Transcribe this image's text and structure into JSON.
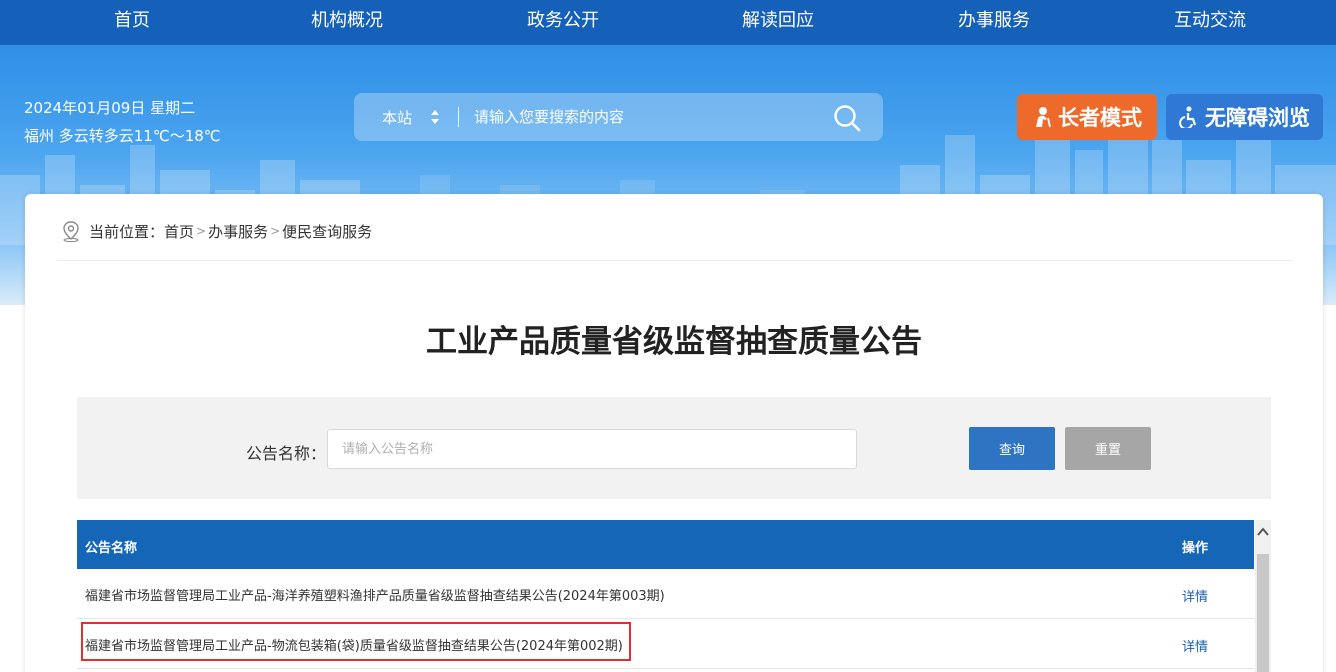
{
  "nav": {
    "items": [
      "首页",
      "机构概况",
      "政务公开",
      "解读回应",
      "办事服务",
      "互动交流"
    ]
  },
  "header": {
    "date": "2024年01月09日 星期二",
    "weather": "福州 多云转多云11℃～18℃",
    "search": {
      "scope": "本站",
      "placeholder": "请输入您要搜索的内容"
    },
    "elder_mode": "长者模式",
    "accessibility": "无障碍浏览"
  },
  "breadcrumb": {
    "prefix": "当前位置：",
    "items": [
      "首页",
      "办事服务",
      "便民查询服务"
    ],
    "separator": ">"
  },
  "page_title": "工业产品质量省级监督抽查质量公告",
  "filter": {
    "label": "公告名称：",
    "placeholder": "请输入公告名称",
    "query_label": "查询",
    "reset_label": "重置"
  },
  "table": {
    "headers": [
      "公告名称",
      "操作"
    ],
    "rows": [
      {
        "name": "福建省市场监督管理局工业产品-海洋养殖塑料渔排产品质量省级监督抽查结果公告(2024年第003期)",
        "action": "详情"
      },
      {
        "name": "福建省市场监督管理局工业产品-物流包装箱(袋)质量省级监督抽查结果公告(2024年第002期)",
        "action": "详情"
      }
    ]
  },
  "colors": {
    "nav_bg": "#1560b8",
    "elder_btn": "#ee6a2b",
    "access_btn": "#2f78d3",
    "table_header": "#1666b8",
    "query_btn": "#2f74c3",
    "reset_btn": "#a6a6a6",
    "highlight": "#e02f2f"
  }
}
